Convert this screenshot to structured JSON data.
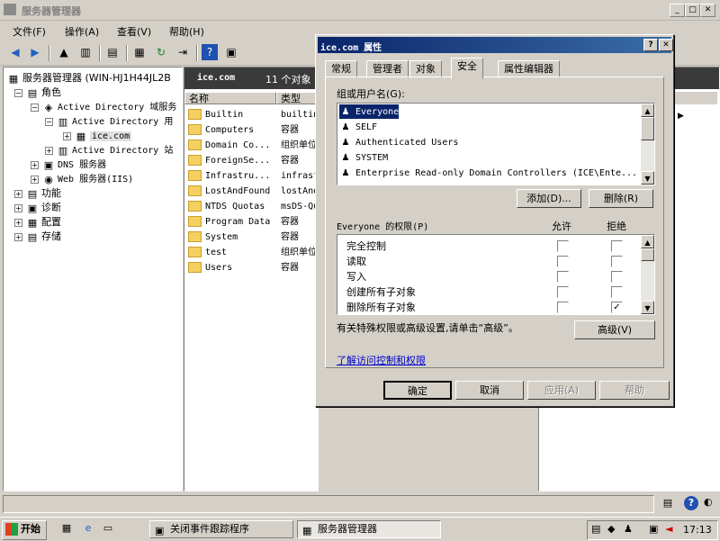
{
  "window": {
    "title": "服务器管理器"
  },
  "menu": [
    "文件(F)",
    "操作(A)",
    "查看(V)",
    "帮助(H)"
  ],
  "tree": {
    "items": [
      {
        "label": "服务器管理器 (WIN-HJ1H44JL2B",
        "level": 0,
        "expander": "",
        "icon": "server-icon",
        "glyph": "▦"
      },
      {
        "label": "角色",
        "level": 1,
        "expander": "−",
        "icon": "roles-icon",
        "glyph": "▤"
      },
      {
        "label": "Active Directory 域服务",
        "level": 2,
        "expander": "−",
        "icon": "ad-icon",
        "glyph": "◈"
      },
      {
        "label": "Active Directory 用",
        "level": 3,
        "expander": "−",
        "icon": "ad-users-icon",
        "glyph": "▥"
      },
      {
        "label": "ice.com",
        "level": 4,
        "expander": "+",
        "icon": "domain-icon",
        "glyph": "▦"
      },
      {
        "label": "Active Directory 站",
        "level": 3,
        "expander": "+",
        "icon": "ad-sites-icon",
        "glyph": "▥"
      },
      {
        "label": "DNS 服务器",
        "level": 2,
        "expander": "+",
        "icon": "dns-icon",
        "glyph": "▣"
      },
      {
        "label": "Web 服务器(IIS)",
        "level": 2,
        "expander": "+",
        "icon": "iis-icon",
        "glyph": "◉"
      },
      {
        "label": "功能",
        "level": 1,
        "expander": "+",
        "icon": "features-icon",
        "glyph": "▤"
      },
      {
        "label": "诊断",
        "level": 1,
        "expander": "+",
        "icon": "diagnostics-icon",
        "glyph": "▣"
      },
      {
        "label": "配置",
        "level": 1,
        "expander": "+",
        "icon": "config-icon",
        "glyph": "▦"
      },
      {
        "label": "存储",
        "level": 1,
        "expander": "+",
        "icon": "storage-icon",
        "glyph": "▤"
      }
    ]
  },
  "list": {
    "header_title": "ice.com",
    "header_count": "11 个对象",
    "col_name": "名称",
    "col_type": "类型",
    "rows": [
      {
        "name": "Builtin",
        "type": "builtin"
      },
      {
        "name": "Computers",
        "type": "容器"
      },
      {
        "name": "Domain Co...",
        "type": "组织单位"
      },
      {
        "name": "ForeignSe...",
        "type": "容器"
      },
      {
        "name": "Infrastru...",
        "type": "infrast"
      },
      {
        "name": "LostAndFound",
        "type": "lostAnd"
      },
      {
        "name": "NTDS Quotas",
        "type": "msDS-Qu"
      },
      {
        "name": "Program Data",
        "type": "容器"
      },
      {
        "name": "System",
        "type": "容器"
      },
      {
        "name": "test",
        "type": "组织单位"
      },
      {
        "name": "Users",
        "type": "容器"
      }
    ]
  },
  "dialog": {
    "title": "ice.com 属性",
    "help": "?",
    "close": "✕",
    "tabs": [
      "常规",
      "管理者",
      "对象",
      "安全",
      "属性编辑器"
    ],
    "active_tab": 3,
    "group_label": "组或用户名(G):",
    "users": [
      "Everyone",
      "SELF",
      "Authenticated Users",
      "SYSTEM",
      "Enterprise Read-only Domain Controllers (ICE\\Ente..."
    ],
    "add_label": "添加(D)...",
    "remove_label": "删除(R)",
    "perm_label": "Everyone 的权限(P)",
    "allow_label": "允许",
    "deny_label": "拒绝",
    "perms": [
      {
        "name": "完全控制",
        "allow": false,
        "deny": false
      },
      {
        "name": "读取",
        "allow": false,
        "deny": false
      },
      {
        "name": "写入",
        "allow": false,
        "deny": false
      },
      {
        "name": "创建所有子对象",
        "allow": false,
        "deny": false
      },
      {
        "name": "删除所有子对象",
        "allow": false,
        "deny": true
      }
    ],
    "advanced_text": "有关特殊权限或高级设置,请单击“高级”。",
    "advanced_label": "高级(V)",
    "link_text": "了解访问控制和权限",
    "ok": "确定",
    "cancel": "取消",
    "apply": "应用(A)",
    "helpbtn": "帮助"
  },
  "taskbar": {
    "start": "开始",
    "tasks": [
      "关闭事件跟踪程序",
      "服务器管理器"
    ],
    "clock": "17:13"
  }
}
